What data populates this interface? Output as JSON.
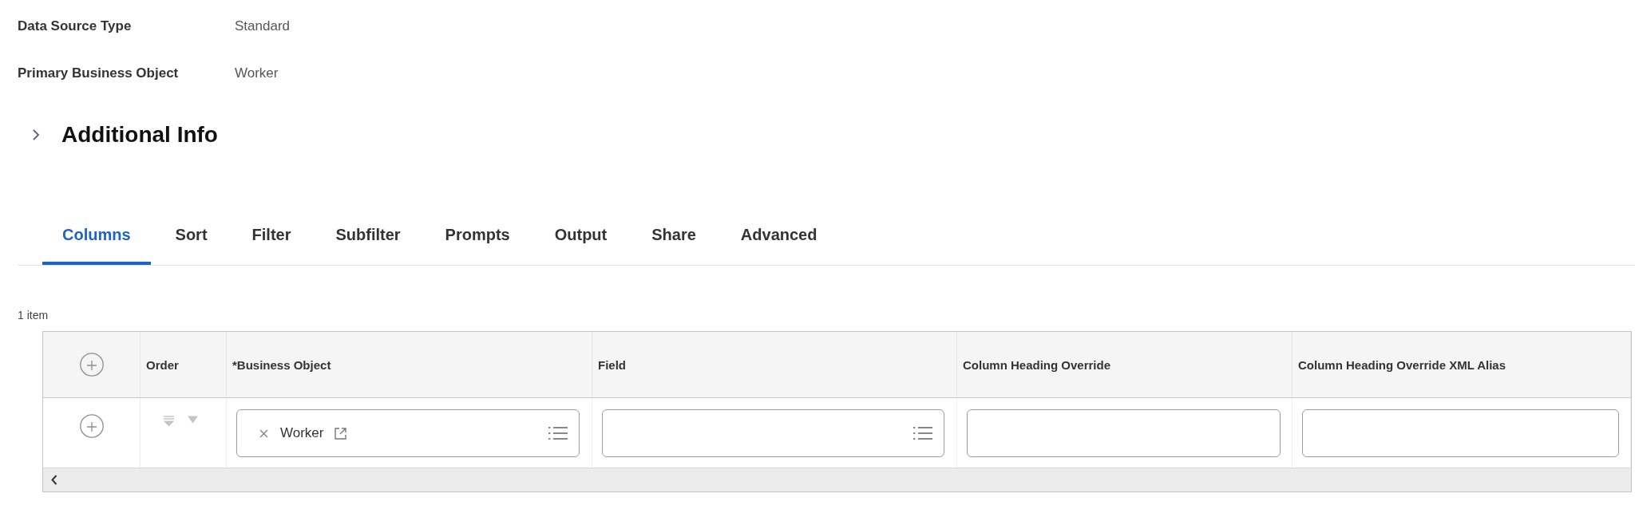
{
  "fields": [
    {
      "label": "Data Source Type",
      "value": "Standard"
    },
    {
      "label": "Primary Business Object",
      "value": "Worker"
    }
  ],
  "section": {
    "title": "Additional Info",
    "expanded": false
  },
  "tabs": [
    {
      "label": "Columns",
      "selected": true
    },
    {
      "label": "Sort",
      "selected": false
    },
    {
      "label": "Filter",
      "selected": false
    },
    {
      "label": "Subfilter",
      "selected": false
    },
    {
      "label": "Prompts",
      "selected": false
    },
    {
      "label": "Output",
      "selected": false
    },
    {
      "label": "Share",
      "selected": false
    },
    {
      "label": "Advanced",
      "selected": false
    }
  ],
  "table": {
    "count": "1 item",
    "columns": [
      {
        "kind": "add"
      },
      {
        "kind": "label",
        "label": "Order"
      },
      {
        "kind": "label",
        "label": "*Business Object"
      },
      {
        "kind": "label",
        "label": "Field"
      },
      {
        "kind": "label",
        "label": "Column Heading Override"
      },
      {
        "kind": "label",
        "label": "Column Heading Override XML Alias"
      }
    ],
    "rows": [
      {
        "cells": [
          {
            "kind": "add"
          },
          {
            "kind": "order",
            "disabled": true
          },
          {
            "kind": "prompt",
            "tokens": [
              {
                "label": "Worker"
              }
            ]
          },
          {
            "kind": "prompt"
          },
          {
            "kind": "input"
          },
          {
            "kind": "input"
          }
        ]
      }
    ]
  }
}
